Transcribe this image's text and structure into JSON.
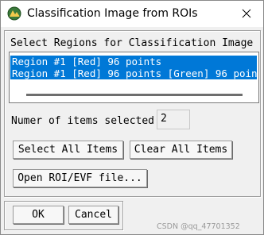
{
  "window": {
    "title": "Classification Image from ROIs"
  },
  "main": {
    "section_label": "Select Regions for Classification Image",
    "regions": [
      "Region #1 [Red] 96 points",
      "Region #1 [Red] 96 points [Green] 96 poin"
    ],
    "count_label": "Numer of items selected:",
    "count_value": "2",
    "select_all_label": "Select All Items",
    "clear_all_label": "Clear All Items",
    "open_label": "Open ROI/EVF file..."
  },
  "footer": {
    "ok_label": "OK",
    "cancel_label": "Cancel",
    "watermark": "CSDN @qq_47701352"
  },
  "colors": {
    "selection": "#0078d7",
    "background": "#f0f0f0"
  },
  "icons": [
    "envi-app-icon",
    "close-icon"
  ]
}
